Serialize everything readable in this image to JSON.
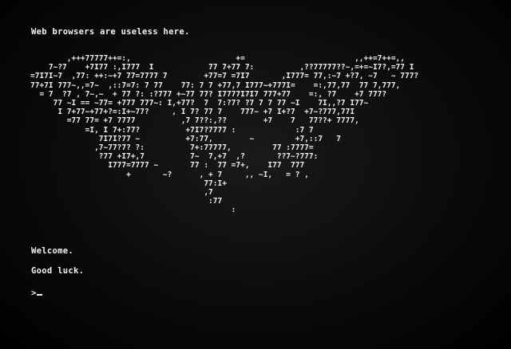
{
  "terminal": {
    "header": "Web browsers are useless here.",
    "ascii_art": "        ,+++77777++=:,                       +=                        ,,++=7++=,,\n    7~?7    +7I77 :,I777  I            77 7+77 7:          ,??77777??~,=+=~I7?,=77 I\n=7I7I~7  ,77: ++:~+7 77=7777 7        +77=7 =7I7       ,I777= 77,:~7 +?7, ~7   ~ 777?\n77+7I 777~,,=7~  ,::7=7: 7 77    77: 7 7 +77,7 I777~+777I=    =:,77,77  77 7,777,\n  = 7  ?7 , 7~,~  + 77 ?: :?777 +~77 77? I7777I7I7 777+77    =:, ?7    +7 777?\n     77 ~I == ~77= +777 777~: I,+77?  7  7:?7? ?7 7 7 77 ~I    7I,,?7 I77~\n      I 7+77~+77+?=:I+~77?     , I 7? 77 7    777~ +7 I+?7  +7~?777,77I\n        =77 77= +7 7777          ,7 7??:,??        +7    7   77??+ 7777,\n            =I, I 7+:77?          +7I7?7777 :             :7 7\n               7I7I?77 ~          +7:77,        ~         +7,::7   7\n              ,7~77?7? ?:          7+:77777,         77 :7777=\n               ?77 +I7+,7          7~  7,+7  ,?       ??7~?777:\n                 I777=7777 ~       77 :  77 =7+,    I77  777\n                     +       ~?      , + 7     ,, ~I,   = ? ,\n                                      77:I+\n                                      ,7\n                                       :77\n                                            :",
    "welcome": "Welcome.",
    "good_luck": "Good luck.",
    "prompt": ">"
  }
}
